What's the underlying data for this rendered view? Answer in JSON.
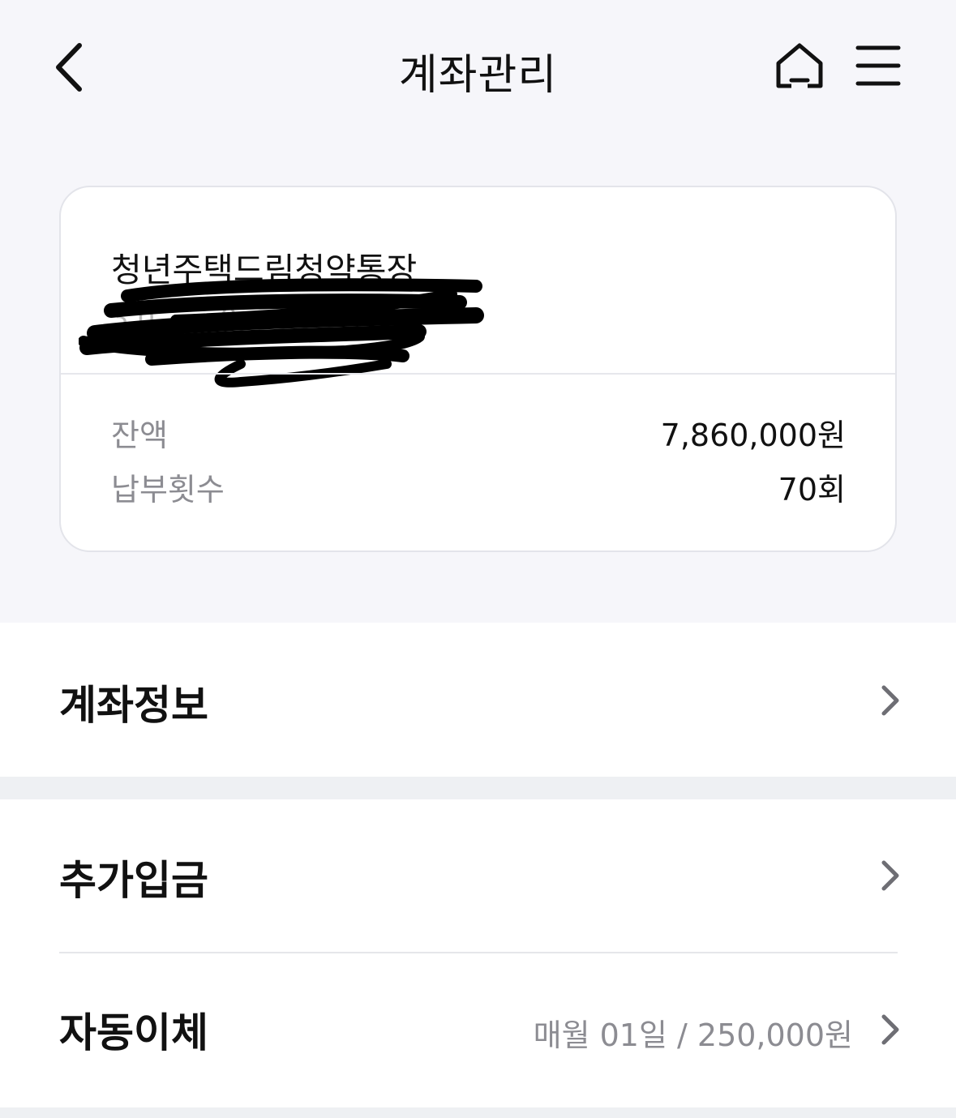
{
  "header": {
    "title": "계좌관리",
    "back_icon": "chevron-left-icon",
    "home_icon": "home-icon",
    "menu_icon": "hamburger-menu-icon"
  },
  "account": {
    "product_name": "청년주택드림청약통장",
    "account_number": "3 0 - - - 0 - -",
    "balance_label": "잔액",
    "balance_value": "7,860,000원",
    "count_label": "납부횟수",
    "count_value": "70회"
  },
  "menu": {
    "account_info": {
      "label": "계좌정보"
    },
    "additional_deposit": {
      "label": "추가입금"
    },
    "auto_transfer": {
      "label": "자동이체",
      "detail": "매월 01일 / 250,000원"
    }
  },
  "colors": {
    "background": "#f6f6fa",
    "card": "#ffffff",
    "label_gray": "#8c8c92",
    "text": "#111111"
  }
}
